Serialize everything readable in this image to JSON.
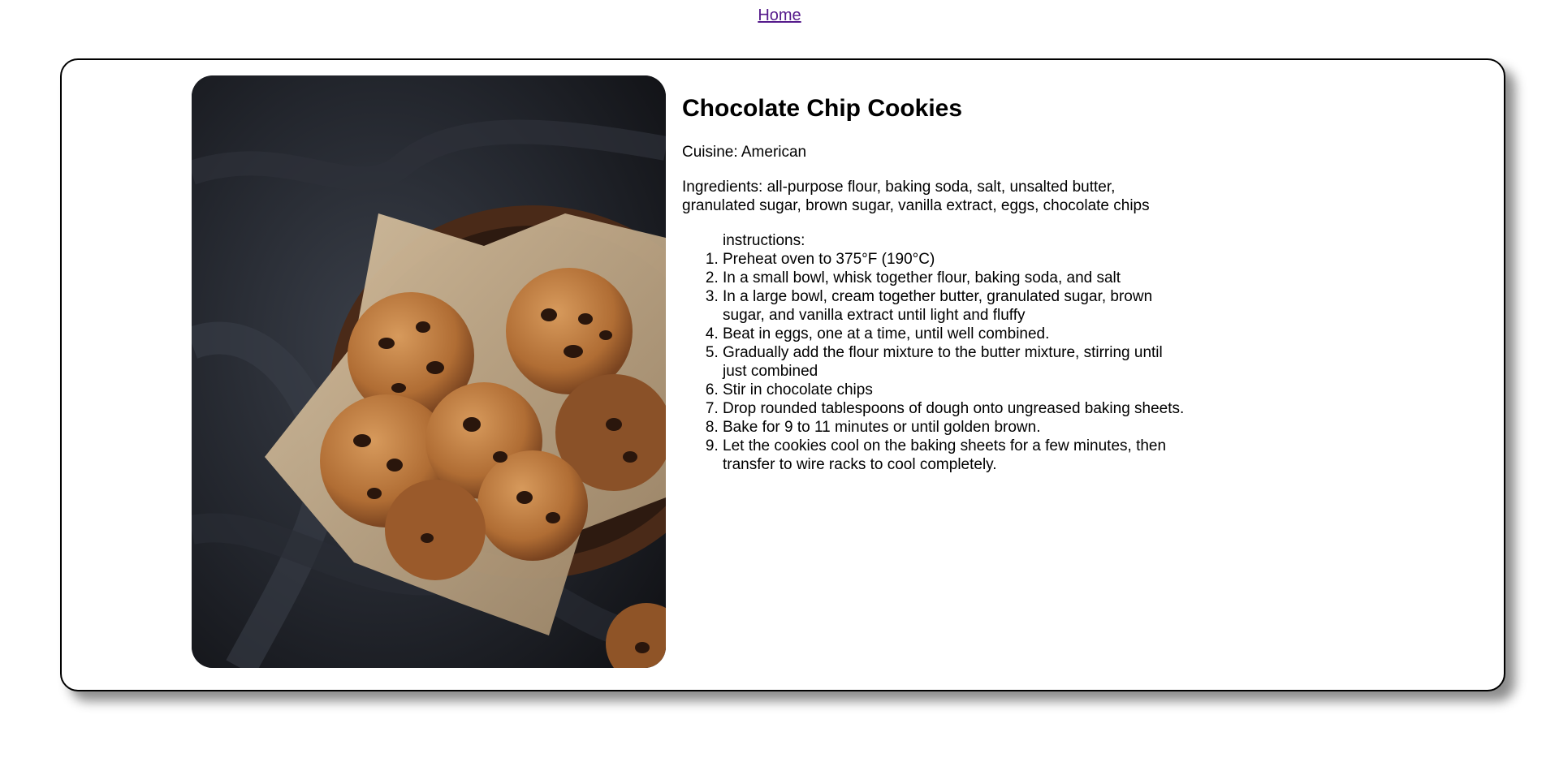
{
  "nav": {
    "home_label": "Home"
  },
  "recipe": {
    "title": "Chocolate Chip Cookies",
    "cuisine": "Cuisine: American",
    "ingredients": "Ingredients: all-purpose flour, baking soda, salt, unsalted butter, granulated sugar, brown sugar, vanilla extract, eggs, chocolate chips",
    "instructions_label": "instructions:",
    "steps": [
      "Preheat oven to 375°F (190°C)",
      "In a small bowl, whisk together flour, baking soda, and salt",
      "In a large bowl, cream together butter, granulated sugar, brown sugar, and vanilla extract until light and fluffy",
      "Beat in eggs, one at a time, until well combined.",
      "Gradually add the flour mixture to the butter mixture, stirring until just combined",
      "Stir in chocolate chips",
      "Drop rounded tablespoons of dough onto ungreased baking sheets.",
      "Bake for 9 to 11 minutes or until golden brown.",
      "Let the cookies cool on the baking sheets for a few minutes, then transfer to wire racks to cool completely."
    ]
  },
  "image": {
    "subject": "cookies-in-bowl-photo"
  }
}
